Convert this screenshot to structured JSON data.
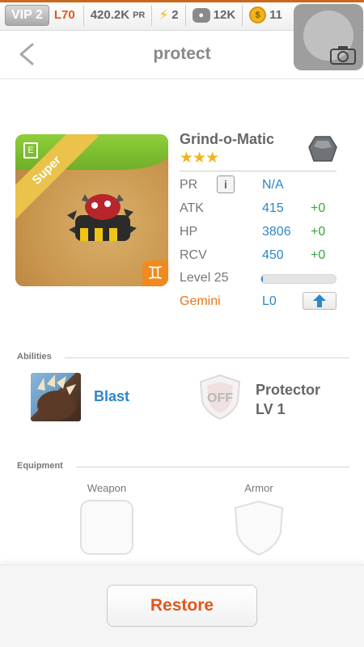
{
  "statusbar": {
    "vip": "VIP 2",
    "level": "L70",
    "power": "420.2K",
    "power_suffix": "PR",
    "energy": "2",
    "food": "12K",
    "coins": "11",
    "add_label": "+"
  },
  "header": {
    "title": "protect"
  },
  "monster": {
    "name": "Grind-o-Matic",
    "rarity": "Super",
    "stars": "★★★",
    "sign_glyph": "♊",
    "stats": [
      {
        "label": "PR",
        "value": "N/A",
        "bonus": ""
      },
      {
        "label": "ATK",
        "value": "415",
        "bonus": "+0"
      },
      {
        "label": "HP",
        "value": "3806",
        "bonus": "+0"
      },
      {
        "label": "RCV",
        "value": "450",
        "bonus": "+0"
      }
    ],
    "info_label": "i",
    "level_label": "Level 25",
    "level_progress": 0.02,
    "sign_label": "Gemini",
    "sign_level": "L0"
  },
  "abilities": {
    "section_label": "Abilities",
    "primary": "Blast",
    "secondary_badge": "OFF",
    "secondary_name": "Protector",
    "secondary_level": "LV 1"
  },
  "equipment": {
    "section_label": "Equipment",
    "weapon_label": "Weapon",
    "armor_label": "Armor"
  },
  "footer": {
    "restore_label": "Restore"
  }
}
